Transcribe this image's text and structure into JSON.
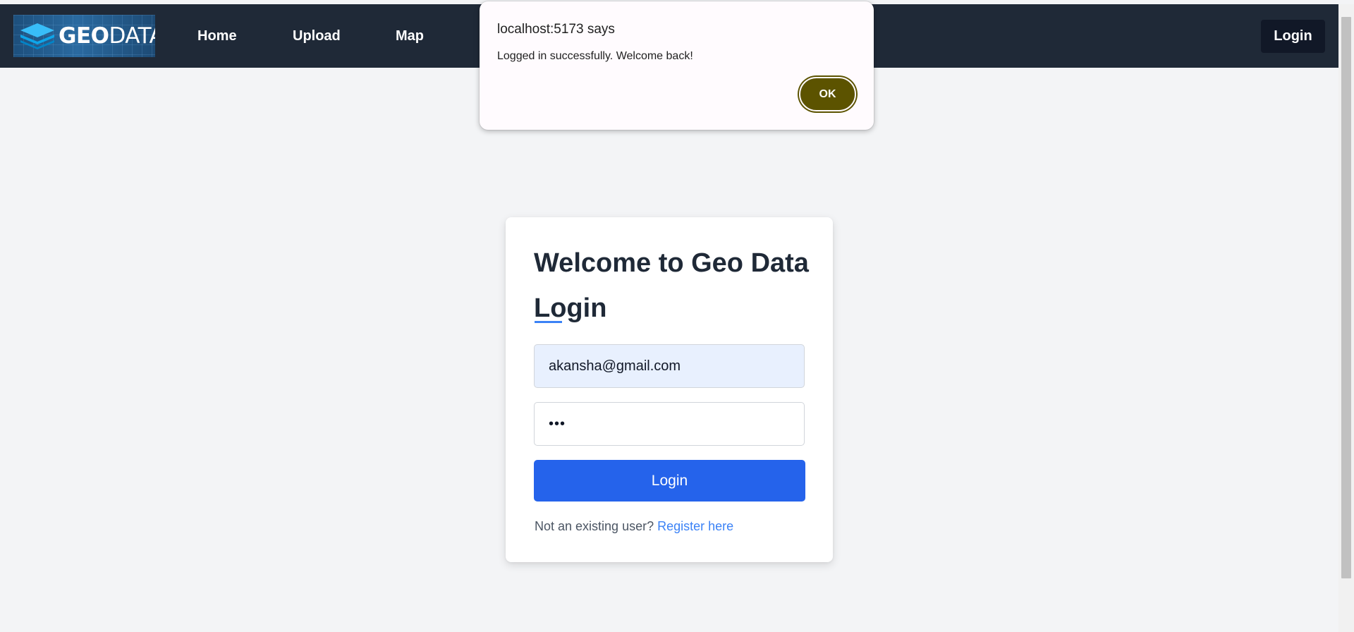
{
  "nav": {
    "logo": {
      "text_bold": "GEO",
      "text_light": "DATA",
      "icon": "layers-icon",
      "colors": [
        "#1d4f7c",
        "#2a6aa0",
        "#0ea5e9"
      ]
    },
    "links": [
      {
        "label": "Home"
      },
      {
        "label": "Upload"
      },
      {
        "label": "Map"
      }
    ],
    "login_label": "Login",
    "background_color": "#1f2937"
  },
  "dialog": {
    "title": "localhost:5173 says",
    "message": "Logged in successfully. Welcome back!",
    "ok_label": "OK",
    "ok_color": "#5c5300"
  },
  "login_card": {
    "title": "Welcome to Geo Data",
    "subtitle": "Login",
    "email_value": "akansha@gmail.com",
    "password_display": "•••",
    "button_label": "Login",
    "button_color": "#2563eb",
    "register_prompt": "Not an existing user?",
    "register_link": "Register here",
    "link_color": "#3b82f6"
  }
}
